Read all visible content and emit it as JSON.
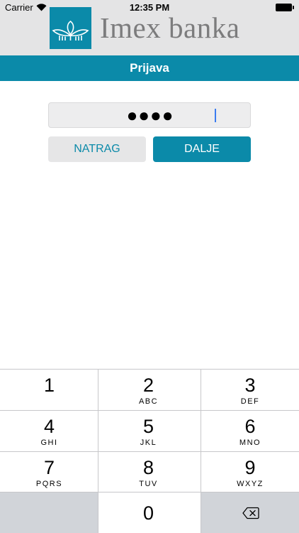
{
  "status_bar": {
    "carrier": "Carrier",
    "time": "12:35 PM"
  },
  "brand": {
    "name": "Imex banka",
    "accent": "#0b8aa9",
    "logo_icon": "leaf-ornament-logo"
  },
  "header": {
    "title": "Prijava"
  },
  "pin": {
    "masked_value": "●●●●",
    "length": 4
  },
  "buttons": {
    "back": "NATRAG",
    "next": "DALJE"
  },
  "keypad": {
    "keys": [
      {
        "digit": "1",
        "letters": ""
      },
      {
        "digit": "2",
        "letters": "ABC"
      },
      {
        "digit": "3",
        "letters": "DEF"
      },
      {
        "digit": "4",
        "letters": "GHI"
      },
      {
        "digit": "5",
        "letters": "JKL"
      },
      {
        "digit": "6",
        "letters": "MNO"
      },
      {
        "digit": "7",
        "letters": "PQRS"
      },
      {
        "digit": "8",
        "letters": "TUV"
      },
      {
        "digit": "9",
        "letters": "WXYZ"
      },
      {
        "digit": "0",
        "letters": ""
      }
    ],
    "delete_icon": "backspace-icon"
  }
}
